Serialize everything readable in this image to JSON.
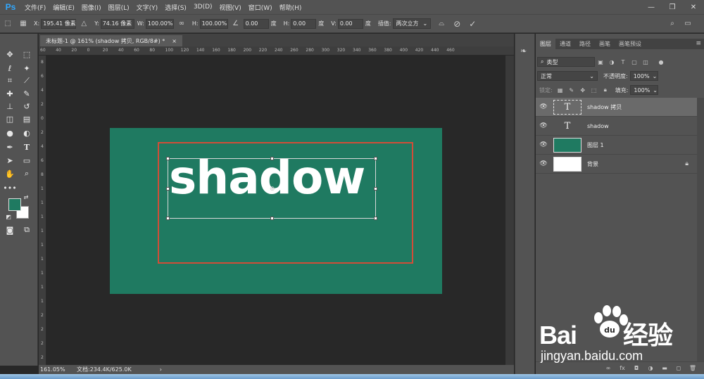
{
  "app": {
    "logo": "Ps"
  },
  "menu": [
    "文件(F)",
    "编辑(E)",
    "图像(I)",
    "图层(L)",
    "文字(Y)",
    "选择(S)",
    "3D(D)",
    "视图(V)",
    "窗口(W)",
    "帮助(H)"
  ],
  "window_controls": {
    "minimize": "—",
    "restore": "❐",
    "close": "✕"
  },
  "options": {
    "x_label": "X:",
    "x_value": "195.41 像素",
    "y_label": "Y:",
    "y_value": "74.16 像素",
    "w_label": "W:",
    "w_value": "100.00%",
    "h_label": "H:",
    "h_value": "100.00%",
    "angle_value": "0.00",
    "angle_unit": "度",
    "hskew_label": "H:",
    "hskew_value": "0.00",
    "hskew_unit": "度",
    "vskew_label": "V:",
    "vskew_value": "0.00",
    "vskew_unit": "度",
    "interp_label": "插值:",
    "interp_value": "两次立方",
    "commit": "✓",
    "cancel": "⊘"
  },
  "document": {
    "tab_title": "未标题-1 @ 161% (shadow 拷贝, RGB/8#) *",
    "tab_close": "×",
    "canvas_color": "#1f7a61",
    "text": "shadow",
    "rect_color": "#d14d38"
  },
  "rulers": {
    "top_labels": [
      "60",
      "40",
      "20",
      "0",
      "20",
      "40",
      "60",
      "80",
      "100",
      "120",
      "140",
      "160",
      "180",
      "200",
      "220",
      "240",
      "260",
      "280",
      "300",
      "320",
      "340",
      "360",
      "380",
      "400",
      "420",
      "440",
      "460"
    ],
    "left_labels": [
      "8",
      "6",
      "4",
      "2",
      "0",
      "2",
      "4",
      "6",
      "8",
      "1",
      "1",
      "1",
      "1",
      "1",
      "1",
      "1",
      "1",
      "1",
      "2",
      "2",
      "2",
      "2"
    ]
  },
  "status": {
    "zoom": "161.05%",
    "doc": "文档:234.4K/625.0K",
    "arrow": "›"
  },
  "layers_panel": {
    "tabs": [
      "图层",
      "通道",
      "路径",
      "画笔",
      "画笔预设"
    ],
    "filter_label": "类型",
    "blend_mode": "正常",
    "opacity_label": "不透明度:",
    "opacity_value": "100%",
    "lock_label": "锁定:",
    "fill_label": "填充:",
    "fill_value": "100%",
    "layers": [
      {
        "name": "shadow 拷贝",
        "thumb": "T",
        "selected": true
      },
      {
        "name": "shadow",
        "thumb": "T",
        "selected": false
      },
      {
        "name": "图层 1",
        "thumb": "",
        "selected": false,
        "thumb_color": "#1f7a61"
      },
      {
        "name": "背景",
        "thumb": "",
        "selected": false,
        "thumb_color": "#ffffff",
        "locked": true
      }
    ],
    "bottom_icons": [
      "link-icon",
      "fx-icon",
      "mask-icon",
      "adjustment-icon",
      "group-icon",
      "new-layer-icon",
      "trash-icon"
    ]
  },
  "watermark": {
    "brand": "Bai",
    "brand_suffix": "经验",
    "site": "jingyan.baidu.com"
  }
}
